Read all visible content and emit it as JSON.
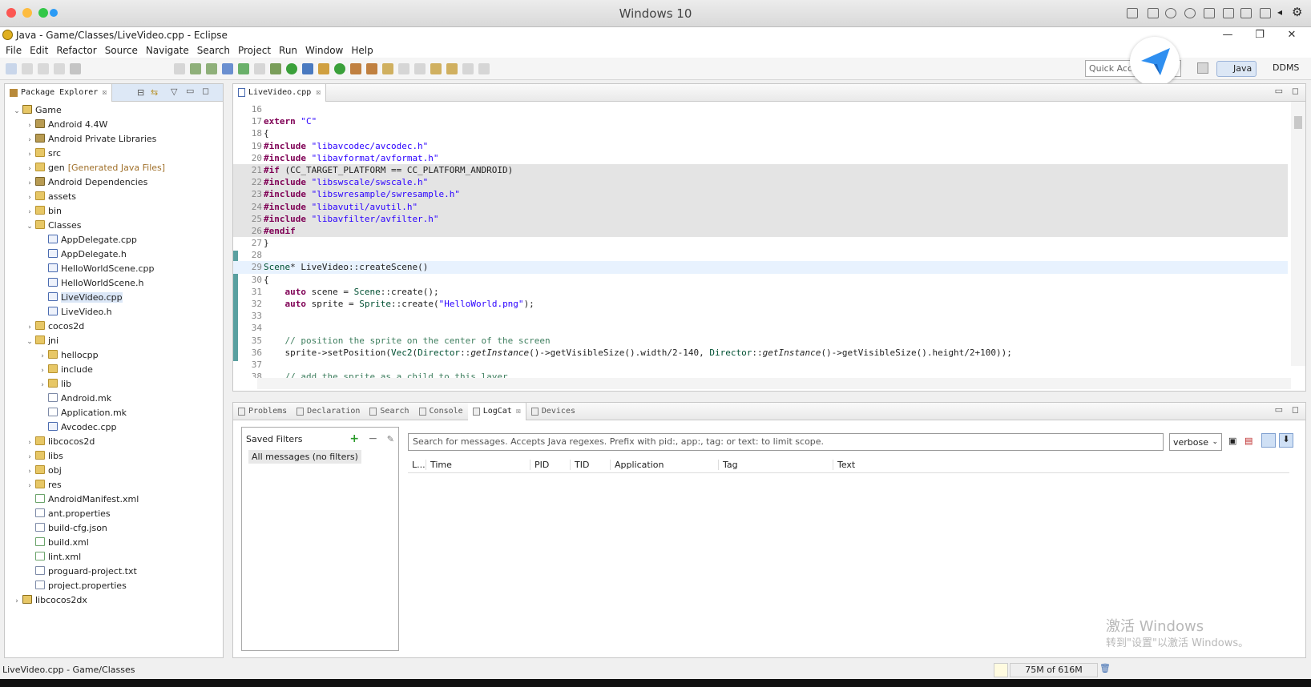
{
  "host": {
    "title": "Windows 10"
  },
  "window": {
    "title": "Java - Game/Classes/LiveVideo.cpp - Eclipse",
    "minimize": "—",
    "maximize": "❐",
    "close": "✕"
  },
  "menu": [
    "File",
    "Edit",
    "Refactor",
    "Source",
    "Navigate",
    "Search",
    "Project",
    "Run",
    "Window",
    "Help"
  ],
  "quick_access": {
    "placeholder": "Quick Acc"
  },
  "perspectives": {
    "java": "Java",
    "ddms": "DDMS"
  },
  "package_explorer": {
    "tab": "Package Explorer",
    "items": [
      {
        "label": "Game",
        "depth": 0,
        "arrow": "v",
        "icon": "proj"
      },
      {
        "label": "Android 4.4W",
        "depth": 1,
        "arrow": ">",
        "icon": "lib"
      },
      {
        "label": "Android Private Libraries",
        "depth": 1,
        "arrow": ">",
        "icon": "lib"
      },
      {
        "label": "src",
        "depth": 1,
        "arrow": ">",
        "icon": "folder"
      },
      {
        "label": "gen",
        "extra": "[Generated Java Files]",
        "depth": 1,
        "arrow": ">",
        "icon": "folder"
      },
      {
        "label": "Android Dependencies",
        "depth": 1,
        "arrow": ">",
        "icon": "lib"
      },
      {
        "label": "assets",
        "depth": 1,
        "arrow": ">",
        "icon": "folder"
      },
      {
        "label": "bin",
        "depth": 1,
        "arrow": ">",
        "icon": "folder"
      },
      {
        "label": "Classes",
        "depth": 1,
        "arrow": "v",
        "icon": "folder"
      },
      {
        "label": "AppDelegate.cpp",
        "depth": 2,
        "arrow": "",
        "icon": "cfile"
      },
      {
        "label": "AppDelegate.h",
        "depth": 2,
        "arrow": "",
        "icon": "cfile"
      },
      {
        "label": "HelloWorldScene.cpp",
        "depth": 2,
        "arrow": "",
        "icon": "cfile"
      },
      {
        "label": "HelloWorldScene.h",
        "depth": 2,
        "arrow": "",
        "icon": "cfile"
      },
      {
        "label": "LiveVideo.cpp",
        "depth": 2,
        "arrow": "",
        "icon": "cfile",
        "selected": true
      },
      {
        "label": "LiveVideo.h",
        "depth": 2,
        "arrow": "",
        "icon": "cfile"
      },
      {
        "label": "cocos2d",
        "depth": 1,
        "arrow": ">",
        "icon": "folder"
      },
      {
        "label": "jni",
        "depth": 1,
        "arrow": "v",
        "icon": "folder"
      },
      {
        "label": "hellocpp",
        "depth": 2,
        "arrow": ">",
        "icon": "folder"
      },
      {
        "label": "include",
        "depth": 2,
        "arrow": ">",
        "icon": "folder"
      },
      {
        "label": "lib",
        "depth": 2,
        "arrow": ">",
        "icon": "folder"
      },
      {
        "label": "Android.mk",
        "depth": 2,
        "arrow": "",
        "icon": "file"
      },
      {
        "label": "Application.mk",
        "depth": 2,
        "arrow": "",
        "icon": "file"
      },
      {
        "label": "Avcodec.cpp",
        "depth": 2,
        "arrow": "",
        "icon": "cfile"
      },
      {
        "label": "libcocos2d",
        "depth": 1,
        "arrow": ">",
        "icon": "folder"
      },
      {
        "label": "libs",
        "depth": 1,
        "arrow": ">",
        "icon": "folder"
      },
      {
        "label": "obj",
        "depth": 1,
        "arrow": ">",
        "icon": "folder"
      },
      {
        "label": "res",
        "depth": 1,
        "arrow": ">",
        "icon": "folder"
      },
      {
        "label": "AndroidManifest.xml",
        "depth": 1,
        "arrow": "",
        "icon": "xml"
      },
      {
        "label": "ant.properties",
        "depth": 1,
        "arrow": "",
        "icon": "file"
      },
      {
        "label": "build-cfg.json",
        "depth": 1,
        "arrow": "",
        "icon": "file"
      },
      {
        "label": "build.xml",
        "depth": 1,
        "arrow": "",
        "icon": "xml"
      },
      {
        "label": "lint.xml",
        "depth": 1,
        "arrow": "",
        "icon": "xml"
      },
      {
        "label": "proguard-project.txt",
        "depth": 1,
        "arrow": "",
        "icon": "file"
      },
      {
        "label": "project.properties",
        "depth": 1,
        "arrow": "",
        "icon": "file"
      },
      {
        "label": "libcocos2dx",
        "depth": 0,
        "arrow": ">",
        "icon": "proj"
      }
    ]
  },
  "editor": {
    "tab": "LiveVideo.cpp",
    "lines": [
      {
        "n": "16",
        "text": ""
      },
      {
        "n": "17",
        "text": "extern \"C\""
      },
      {
        "n": "18",
        "text": "{"
      },
      {
        "n": "19",
        "text": "#include \"libavcodec/avcodec.h\""
      },
      {
        "n": "20",
        "text": "#include \"libavformat/avformat.h\""
      },
      {
        "n": "21",
        "text": "#if (CC_TARGET_PLATFORM == CC_PLATFORM_ANDROID)",
        "hl": "gray"
      },
      {
        "n": "22",
        "text": "#include \"libswscale/swscale.h\"",
        "hl": "gray"
      },
      {
        "n": "23",
        "text": "#include \"libswresample/swresample.h\"",
        "hl": "gray"
      },
      {
        "n": "24",
        "text": "#include \"libavutil/avutil.h\"",
        "hl": "gray"
      },
      {
        "n": "25",
        "text": "#include \"libavfilter/avfilter.h\"",
        "hl": "gray"
      },
      {
        "n": "26",
        "text": "#endif",
        "hl": "gray"
      },
      {
        "n": "27",
        "text": "}"
      },
      {
        "n": "28",
        "text": ""
      },
      {
        "n": "29",
        "text": "Scene* LiveVideo::createScene()",
        "hl": "blue"
      },
      {
        "n": "30",
        "text": "{"
      },
      {
        "n": "31",
        "text": "    auto scene = Scene::create();"
      },
      {
        "n": "32",
        "text": "    auto sprite = Sprite::create(\"HelloWorld.png\");"
      },
      {
        "n": "33",
        "text": ""
      },
      {
        "n": "34",
        "text": ""
      },
      {
        "n": "35",
        "text": "    // position the sprite on the center of the screen"
      },
      {
        "n": "36",
        "text": "    sprite->setPosition(Vec2(Director::getInstance()->getVisibleSize().width/2-140, Director::getInstance()->getVisibleSize().height/2+100));"
      },
      {
        "n": "37",
        "text": ""
      },
      {
        "n": "38",
        "text": "    // add the sprite as a child to this layer"
      }
    ]
  },
  "bottom_tabs": [
    {
      "label": "Problems",
      "active": false
    },
    {
      "label": "Declaration",
      "active": false
    },
    {
      "label": "Search",
      "active": false
    },
    {
      "label": "Console",
      "active": false
    },
    {
      "label": "LogCat",
      "active": true
    },
    {
      "label": "Devices",
      "active": false
    }
  ],
  "logcat": {
    "saved_filters": "Saved Filters",
    "all_messages": "All messages (no filters)",
    "search_placeholder": "Search for messages. Accepts Java regexes. Prefix with pid:, app:, tag: or text: to limit scope.",
    "level": "verbose",
    "columns": [
      "L...",
      "Time",
      "PID",
      "TID",
      "Application",
      "Tag",
      "Text"
    ]
  },
  "status": {
    "left": "LiveVideo.cpp - Game/Classes",
    "heap": "75M of 616M"
  },
  "watermark": {
    "line1": "激活 Windows",
    "line2": "转到\"设置\"以激活 Windows。"
  },
  "colors": {
    "selection": "#dbe7f7",
    "keyword": "#7f0055",
    "string": "#2a00ff",
    "comment": "#3f7f5f"
  }
}
